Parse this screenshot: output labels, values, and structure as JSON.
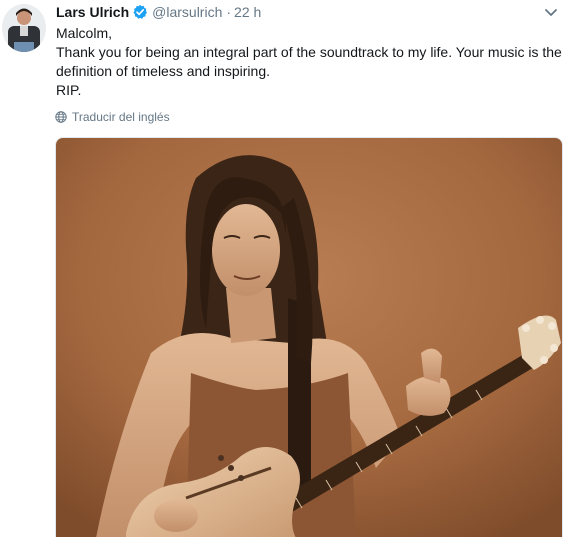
{
  "tweet": {
    "author": {
      "name": "Lars Ulrich",
      "handle": "@larsulrich",
      "verified": true,
      "avatar_icon": "profile-photo"
    },
    "separator": "·",
    "time": "22 h",
    "menu_icon": "chevron-down-icon",
    "text_lines": [
      "Malcolm,",
      "Thank you for being an integral part of the soundtrack to my life. Your music is the definition of timeless and inspiring.",
      "RIP."
    ],
    "translate_label": "Traducir del inglés",
    "translate_icon": "globe-icon",
    "media": {
      "kind": "photo",
      "icon": "photo-guitarist-icon"
    }
  },
  "colors": {
    "verified_badge": "#1da1f2",
    "secondary_text": "#657786",
    "primary_text": "#14171a",
    "photo_sepia": "#a4683f"
  }
}
